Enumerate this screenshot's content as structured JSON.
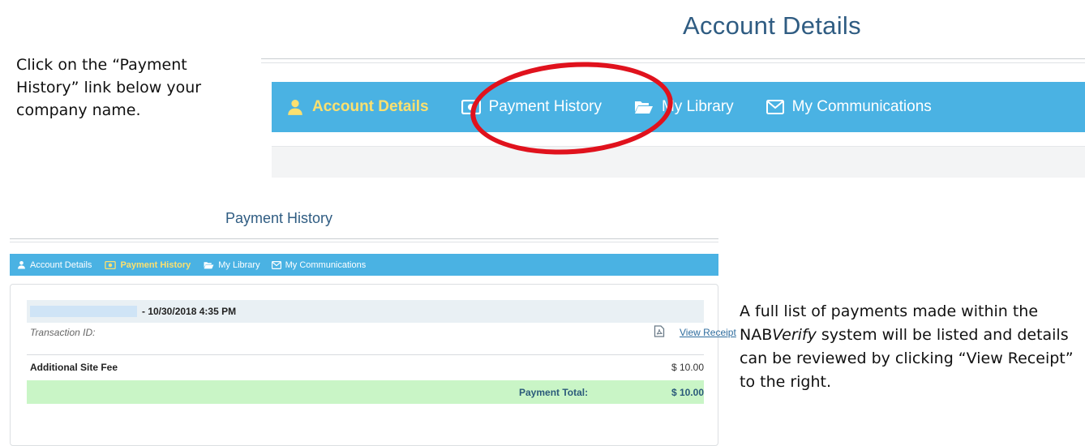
{
  "instructions": {
    "top": "Click on the “Payment History” link below your company name.",
    "bottom_before": "A full list of payments made within the NAB",
    "bottom_italic": "Verify",
    "bottom_after": " system will be listed and details can be reviewed by clicking “View Receipt” to the right."
  },
  "zoomed": {
    "title": "Account Details",
    "nav": [
      {
        "label": "Account Details",
        "icon": "user-icon",
        "active": true
      },
      {
        "label": "Payment History",
        "icon": "money-icon",
        "active": false
      },
      {
        "label": "My Library",
        "icon": "folder-open-icon",
        "active": false
      },
      {
        "label": "My Communications",
        "icon": "envelope-icon",
        "active": false
      }
    ]
  },
  "page": {
    "title": "Payment History",
    "nav": [
      {
        "label": "Account Details",
        "icon": "user-icon",
        "active": false
      },
      {
        "label": "Payment History",
        "icon": "money-icon",
        "active": true
      },
      {
        "label": "My Library",
        "icon": "folder-open-icon",
        "active": false
      },
      {
        "label": "My Communications",
        "icon": "envelope-icon",
        "active": false
      }
    ],
    "transaction": {
      "datetime": "- 10/30/2018 4:35 PM",
      "id_label": "Transaction ID:",
      "receipt_link": "View Receipt",
      "items": [
        {
          "description": "Additional Site Fee",
          "amount": "$ 10.00"
        }
      ],
      "total_label": "Payment Total:",
      "total_amount": "$ 10.00"
    }
  },
  "colors": {
    "nav_bg": "#4ab2e3",
    "nav_active": "#fce06f",
    "title": "#2f5c82",
    "highlight_circle": "#e0121d",
    "total_row_bg": "#c9f5c6"
  }
}
